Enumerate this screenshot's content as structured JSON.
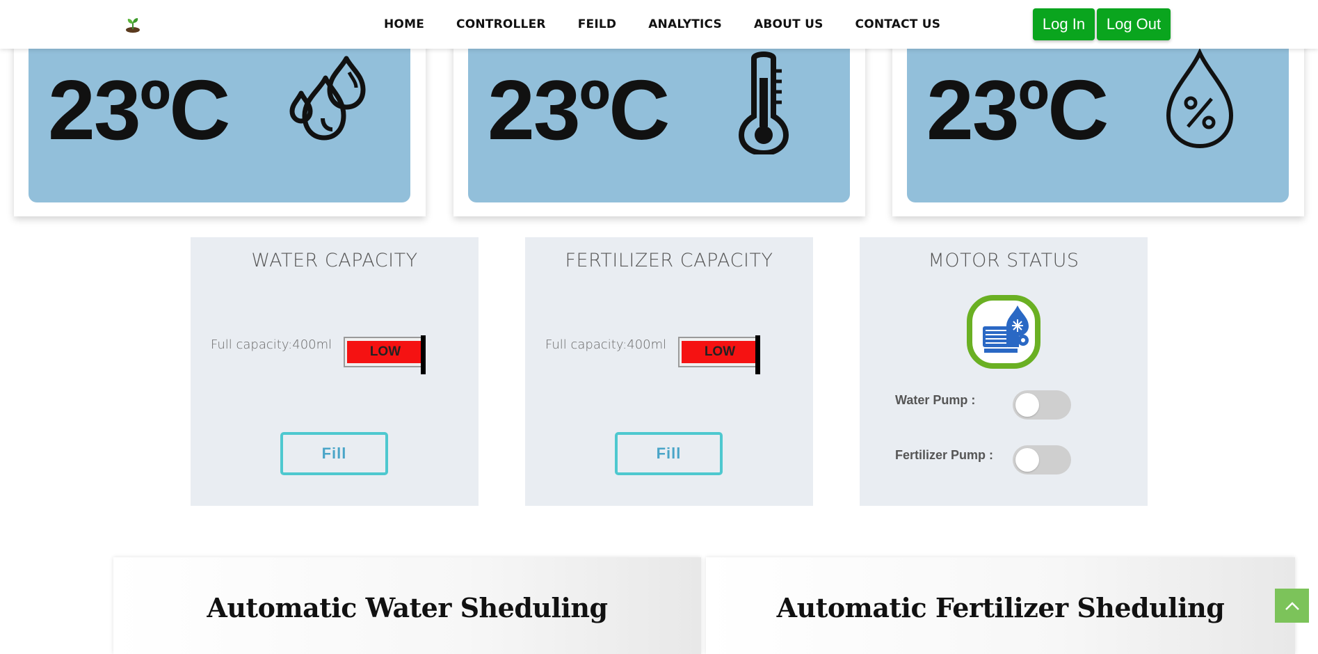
{
  "nav": {
    "logo_icon": "seedling-logo-icon",
    "links": [
      "HOME",
      "CONTROLLER",
      "FEILD",
      "ANALYTICS",
      "ABOUT US",
      "CONTACT US"
    ],
    "login_label": "Log In",
    "logout_label": "Log Out",
    "button_color": "#0aa51e"
  },
  "sensor_cards": [
    {
      "value": "23ºC",
      "icon": "water-drops-icon"
    },
    {
      "value": "23ºC",
      "icon": "thermometer-icon"
    },
    {
      "value": "23ºC",
      "icon": "humidity-percent-icon"
    }
  ],
  "water_capacity": {
    "title": "WATER CAPACITY",
    "capacity_label": "Full capacity:400ml",
    "level_label": "LOW",
    "fill_label": "Fill"
  },
  "fertilizer_capacity": {
    "title": "FERTILIZER CAPACITY",
    "capacity_label": "Full capacity:400ml",
    "level_label": "LOW",
    "fill_label": "Fill"
  },
  "motor_status": {
    "title": "MOTOR STATUS",
    "icon": "motor-pump-icon",
    "water_pump_label": "Water Pump :",
    "fertilizer_pump_label": "Fertilizer Pump :",
    "water_pump_on": false,
    "fertilizer_pump_on": false
  },
  "scheduling": {
    "water_title": "Automatic Water Sheduling",
    "fertilizer_title": "Automatic Fertilizer Sheduling"
  },
  "colors": {
    "card_blue": "#92bfda",
    "low_red": "#f51212",
    "fill_teal": "#4ec8cf",
    "scroll_top_green": "#7cc35a"
  }
}
